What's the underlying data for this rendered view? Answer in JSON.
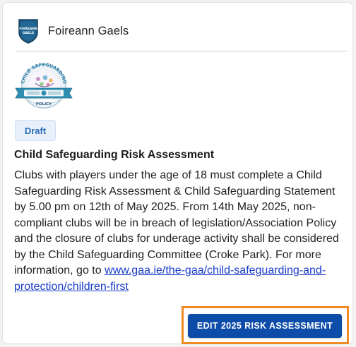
{
  "club": {
    "name": "Foireann Gaels",
    "crest_icon": "shield-crest-icon",
    "crest_text_line1": "FOIREANN",
    "crest_text_line2": "GAELS"
  },
  "policy_logo": {
    "icon": "child-safeguarding-policy-badge",
    "arc_text": "CHILD SAFEGUARDING",
    "bottom_text": "POLICY"
  },
  "card": {
    "status_badge": "Draft",
    "title": "Child Safeguarding Risk Assessment",
    "body_text": "Clubs with players under the age of 18 must complete a Child Safeguarding Risk Assessment & Child Safeguarding Statement by 5.00 pm on 12th of May 2025. From 14th May 2025, non-compliant clubs will be in breach of legislation/Association Policy and the closure of clubs for underage activity shall be considered by the Child Safeguarding Committee (Croke Park). For more information, go to ",
    "link_text": "www.gaa.ie/the-gaa/child-safeguarding-and-protection/children-first",
    "action_button": "EDIT 2025 RISK ASSESSMENT"
  },
  "colors": {
    "accent": "#0d4ca8",
    "badge_bg": "#e8f1fb",
    "badge_text": "#2b6db4",
    "link": "#1a3cc8",
    "highlight": "#f08a24"
  }
}
